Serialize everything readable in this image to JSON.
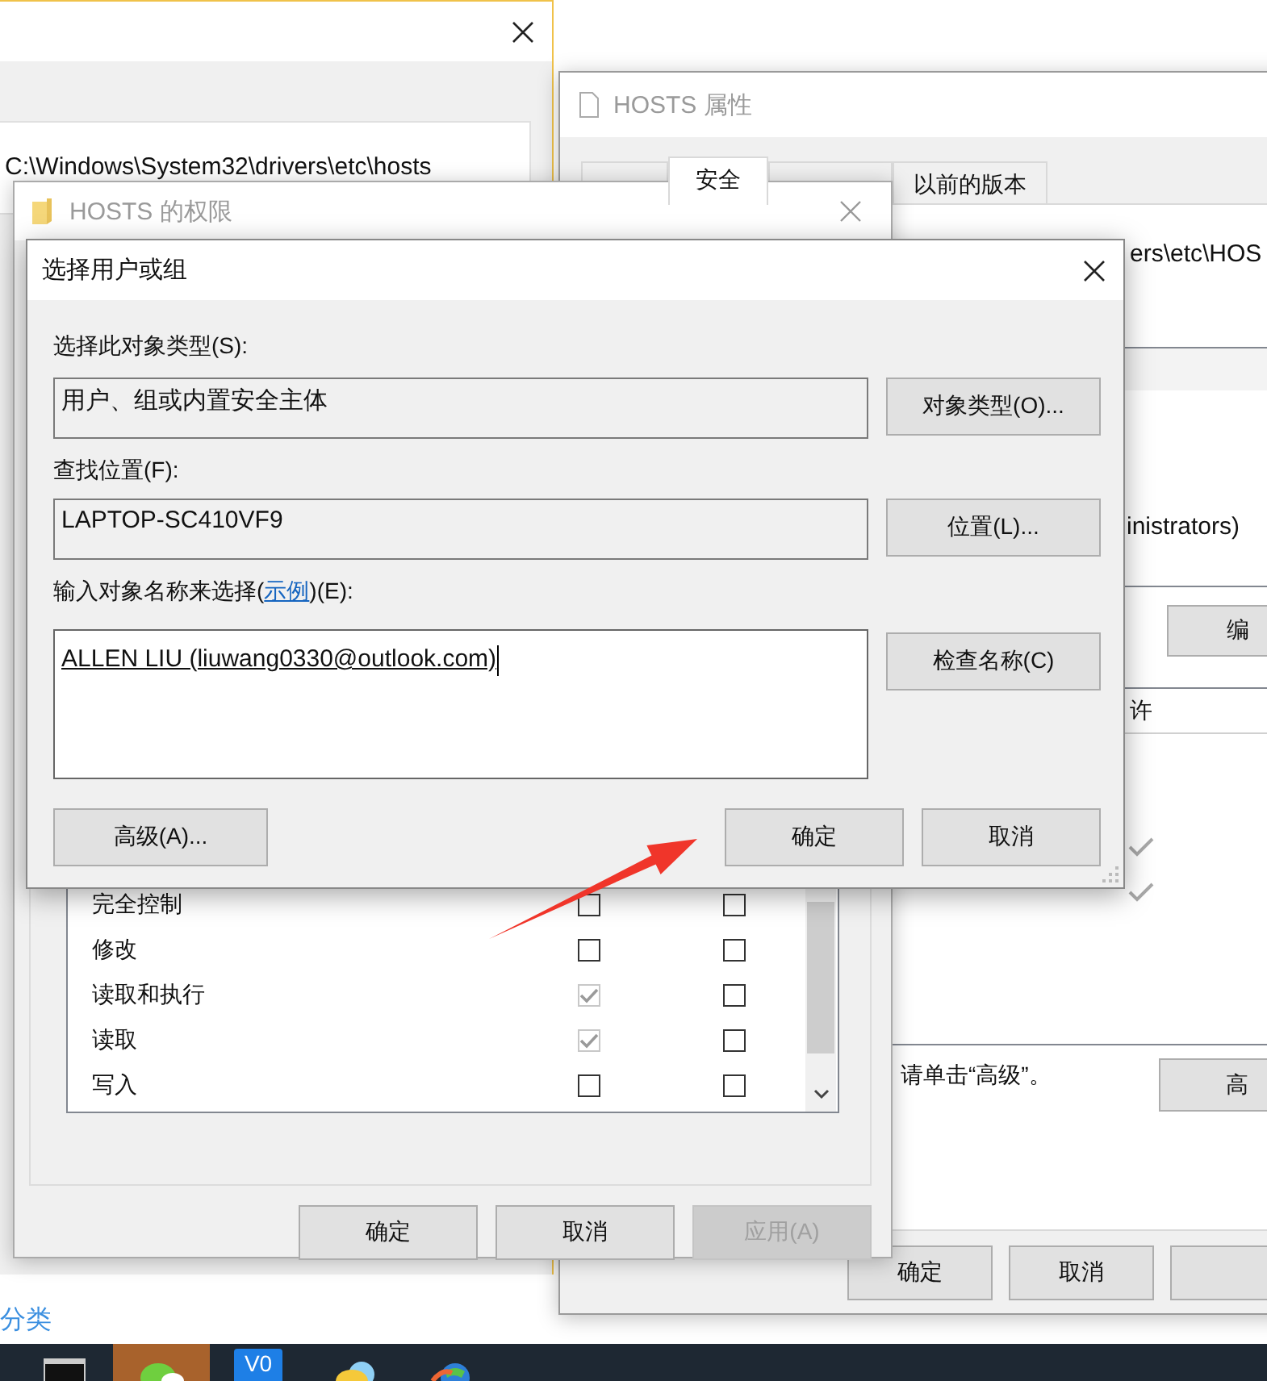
{
  "background_window": {
    "path": "C:\\Windows\\System32\\drivers\\etc\\hosts"
  },
  "desktop_link": "分类",
  "properties_window": {
    "title": "HOSTS 属性",
    "tabs": [
      {
        "selected": false
      },
      {
        "label": "安全",
        "selected": true
      },
      {
        "selected": false
      },
      {
        "label": "以前的版本",
        "selected": false
      }
    ],
    "object_path": "ers\\etc\\HOS",
    "group_item": "inistrators)",
    "edit_button": "编",
    "permission_header": "许",
    "permission_rows": [
      {
        "allowed": false
      },
      {
        "allowed": false
      },
      {
        "allowed": true
      },
      {
        "allowed": true
      }
    ],
    "advanced_hint": "请单击“高级”。",
    "advanced_button": "高",
    "buttons": [
      "确定",
      "取消"
    ]
  },
  "permissions_window": {
    "title": "HOSTS 的权限",
    "permissions": [
      {
        "name": "完全控制",
        "allow": false,
        "allow_disabled": false,
        "deny": false
      },
      {
        "name": "修改",
        "allow": false,
        "allow_disabled": false,
        "deny": false
      },
      {
        "name": "读取和执行",
        "allow": true,
        "allow_disabled": true,
        "deny": false
      },
      {
        "name": "读取",
        "allow": true,
        "allow_disabled": true,
        "deny": false
      },
      {
        "name": "写入",
        "allow": false,
        "allow_disabled": false,
        "deny": false
      }
    ],
    "buttons": [
      {
        "label": "确定",
        "disabled": false
      },
      {
        "label": "取消",
        "disabled": false
      },
      {
        "label": "应用(A)",
        "disabled": true
      }
    ]
  },
  "select_dialog": {
    "title": "选择用户或组",
    "object_type_label": "选择此对象类型(S):",
    "object_type": "用户、组或内置安全主体",
    "object_type_button": "对象类型(O)...",
    "location_label": "查找位置(F):",
    "location": "LAPTOP-SC410VF9",
    "location_button": "位置(L)...",
    "names_label": {
      "before": "输入对象名称来选择(",
      "link": "示例",
      "after": ")(E):"
    },
    "names_value": "ALLEN LIU (liuwang0330@outlook.com)",
    "check_names_button": "检查名称(C)",
    "advanced_button": "高级(A)...",
    "ok_button": "确定",
    "cancel_button": "取消"
  },
  "taskbar": {
    "items": [
      {
        "kind": "terminal",
        "selected": false
      },
      {
        "kind": "chat",
        "selected": true
      },
      {
        "kind": "badge",
        "label": "V0",
        "selected": false
      },
      {
        "kind": "cloud",
        "selected": false
      },
      {
        "kind": "globe",
        "selected": false
      }
    ]
  }
}
